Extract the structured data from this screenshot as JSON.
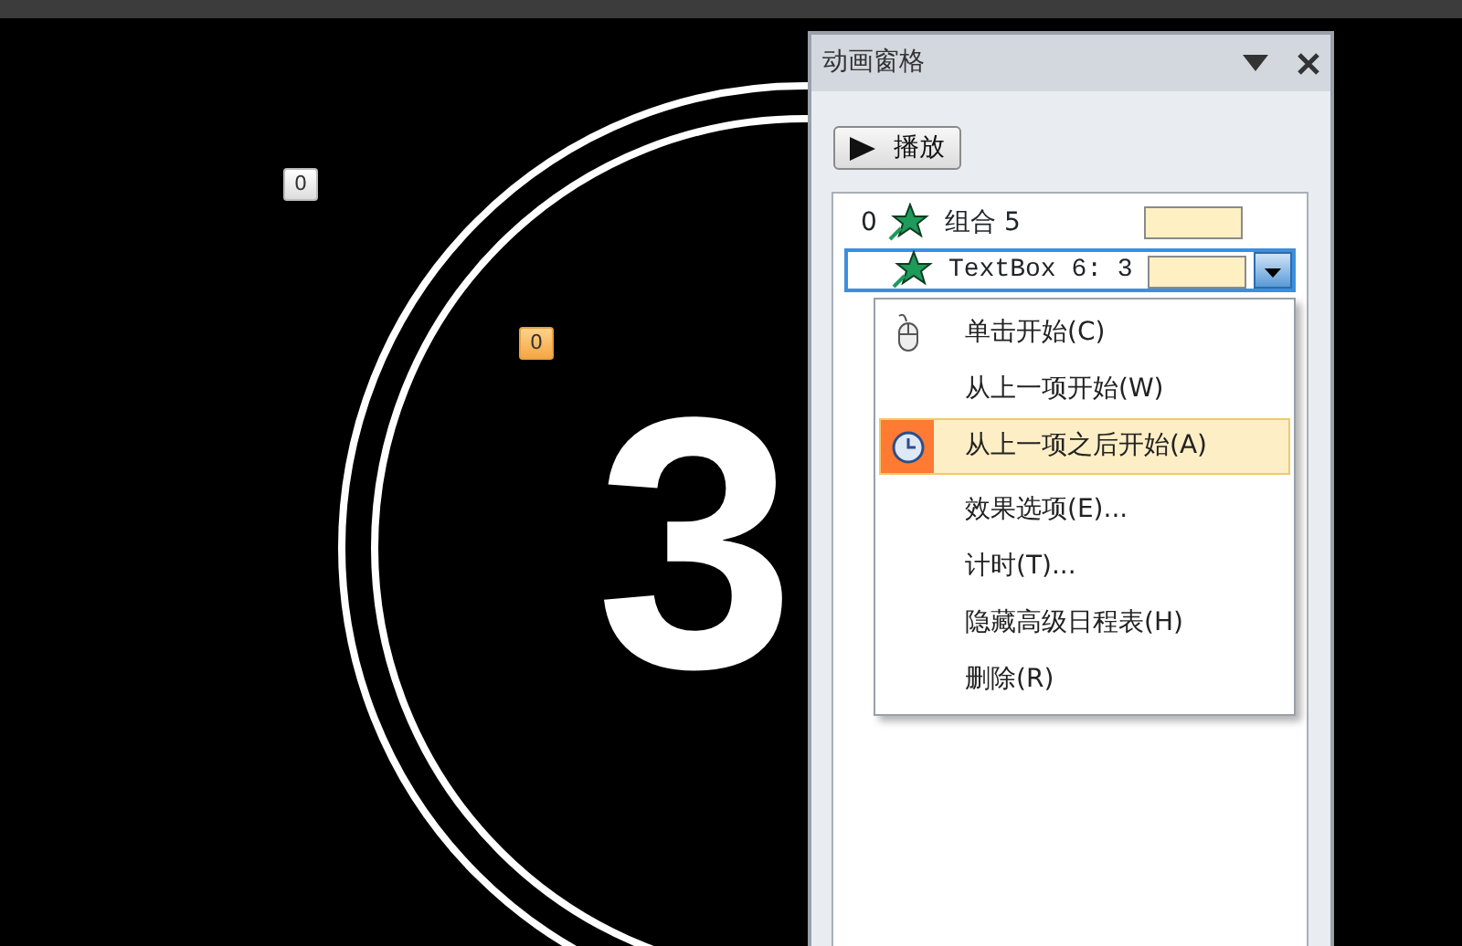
{
  "slide": {
    "big_number": "3",
    "tags": [
      {
        "label": "0",
        "selected": false
      },
      {
        "label": "0",
        "selected": true
      }
    ]
  },
  "pane": {
    "title": "动画窗格",
    "play_button": "播放",
    "items": [
      {
        "number": "0",
        "label": "组合 5",
        "selected": false
      },
      {
        "label": "TextBox 6: 3",
        "selected": true
      }
    ],
    "menu": [
      {
        "label": "单击开始(C)",
        "kind": "mouse",
        "selected": false
      },
      {
        "label": "从上一项开始(W)",
        "kind": "plain",
        "selected": false
      },
      {
        "label": "从上一项之后开始(A)",
        "kind": "clock",
        "selected": true
      },
      {
        "label": "效果选项(E)...",
        "kind": "plain",
        "selected": false
      },
      {
        "label": "计时(T)...",
        "kind": "plain",
        "selected": false
      },
      {
        "label": "隐藏高级日程表(H)",
        "kind": "plain",
        "selected": false
      },
      {
        "label": "删除(R)",
        "kind": "plain",
        "selected": false
      }
    ]
  }
}
